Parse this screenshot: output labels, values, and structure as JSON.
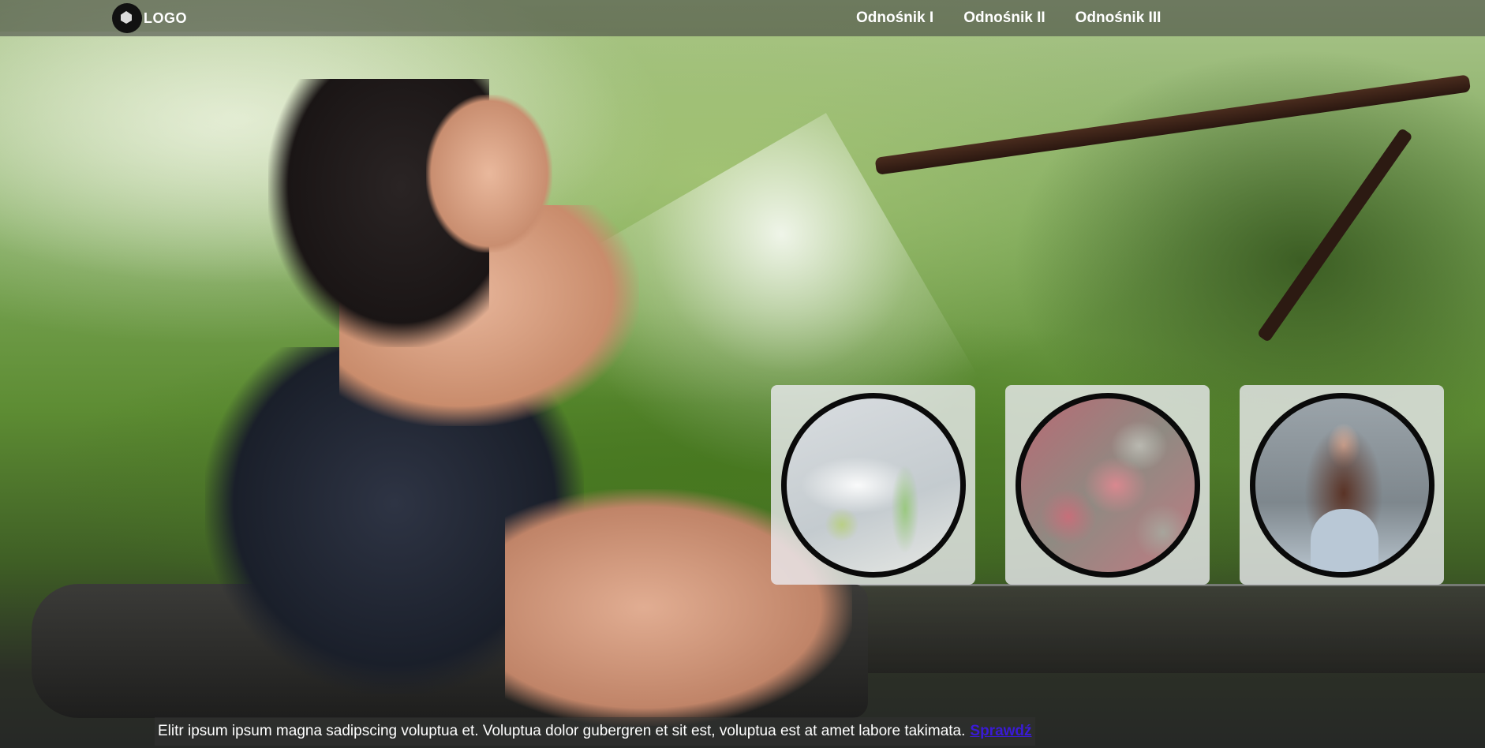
{
  "header": {
    "logo_text": "LOGO",
    "nav": [
      {
        "label": "Odnośnik I"
      },
      {
        "label": "Odnośnik II"
      },
      {
        "label": "Odnośnik III"
      }
    ]
  },
  "hero": {
    "background": "woman-splashing-water-photo"
  },
  "cards": [
    {
      "image": "spa-products-photo"
    },
    {
      "image": "handmade-soap-bars-photo"
    },
    {
      "image": "portrait-woman-photo"
    }
  ],
  "footer": {
    "text": "Elitr ipsum ipsum magna sadipscing voluptua et. Voluptua dolor gubergren et sit est, voluptua est at amet labore takimata.",
    "link_label": "Sprawdź"
  },
  "colors": {
    "nav_text": "#ffffff",
    "link_color": "#3a1bd6",
    "card_bg": "#ebebf0",
    "circle_border": "#0a0a0a"
  }
}
